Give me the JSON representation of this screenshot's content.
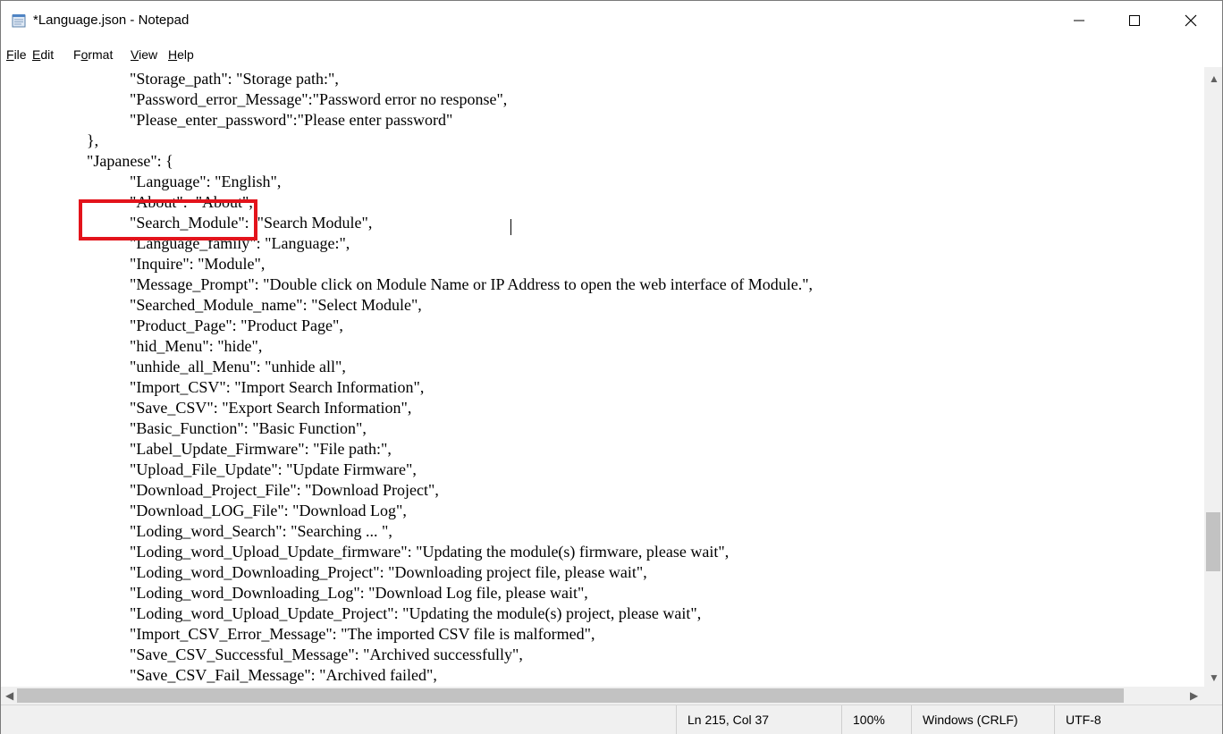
{
  "window": {
    "title": "*Language.json - Notepad"
  },
  "titlebar_buttons": {
    "minimize_icon": "minimize-icon",
    "maximize_icon": "maximize-icon",
    "close_icon": "close-icon"
  },
  "menu": [
    {
      "label": "File",
      "accel": "F",
      "rest": "ile"
    },
    {
      "label": "Edit",
      "accel": "E",
      "rest": "dit"
    },
    {
      "label": "Format",
      "pre": "F",
      "accel": "o",
      "rest": "rmat"
    },
    {
      "label": "View",
      "accel": "V",
      "rest": "iew"
    },
    {
      "label": "Help",
      "accel": "H",
      "rest": "elp"
    }
  ],
  "editor": {
    "lines": [
      "\t\t\t\"Storage_path\": \"Storage path:\",",
      "\t\t\t\"Password_error_Message\":\"Password error no response\",",
      "\t\t\t\"Please_enter_password\":\"Please enter password\"",
      "\t\t},",
      "\t\t\"Japanese\": {",
      "\t\t\t\"Language\": \"English\",",
      "\t\t\t\"About\":  \"About\",",
      "\t\t\t\"Search_Module\":  \"Search Module\",",
      "\t\t\t\"Language_family\": \"Language:\",",
      "\t\t\t\"Inquire\": \"Module\",",
      "\t\t\t\"Message_Prompt\": \"Double click on Module Name or IP Address to open the web interface of Module.\",",
      "\t\t\t\"Searched_Module_name\": \"Select Module\",",
      "\t\t\t\"Product_Page\": \"Product Page\",",
      "\t\t\t\"hid_Menu\": \"hide\",",
      "\t\t\t\"unhide_all_Menu\": \"unhide all\",",
      "\t\t\t\"Import_CSV\": \"Import Search Information\",",
      "\t\t\t\"Save_CSV\": \"Export Search Information\",",
      "\t\t\t\"Basic_Function\": \"Basic Function\",",
      "\t\t\t\"Label_Update_Firmware\": \"File path:\",",
      "\t\t\t\"Upload_File_Update\": \"Update Firmware\",",
      "\t\t\t\"Download_Project_File\": \"Download Project\",",
      "\t\t\t\"Download_LOG_File\": \"Download Log\",",
      "\t\t\t\"Loding_word_Search\": \"Searching ... \",",
      "\t\t\t\"Loding_word_Upload_Update_firmware\": \"Updating the module(s) firmware, please wait\",",
      "\t\t\t\"Loding_word_Downloading_Project\": \"Downloading project file, please wait\",",
      "\t\t\t\"Loding_word_Downloading_Log\": \"Download Log file, please wait\",",
      "\t\t\t\"Loding_word_Upload_Update_Project\": \"Updating the module(s) project, please wait\",",
      "\t\t\t\"Import_CSV_Error_Message\": \"The imported CSV file is malformed\",",
      "\t\t\t\"Save_CSV_Successful_Message\": \"Archived successfully\",",
      "\t\t\t\"Save_CSV_Fail_Message\": \"Archived failed\","
    ]
  },
  "status": {
    "position": "Ln 215, Col 37",
    "zoom": "100%",
    "line_ending": "Windows (CRLF)",
    "encoding": "UTF-8"
  },
  "colors": {
    "highlight": "#e3131b"
  }
}
